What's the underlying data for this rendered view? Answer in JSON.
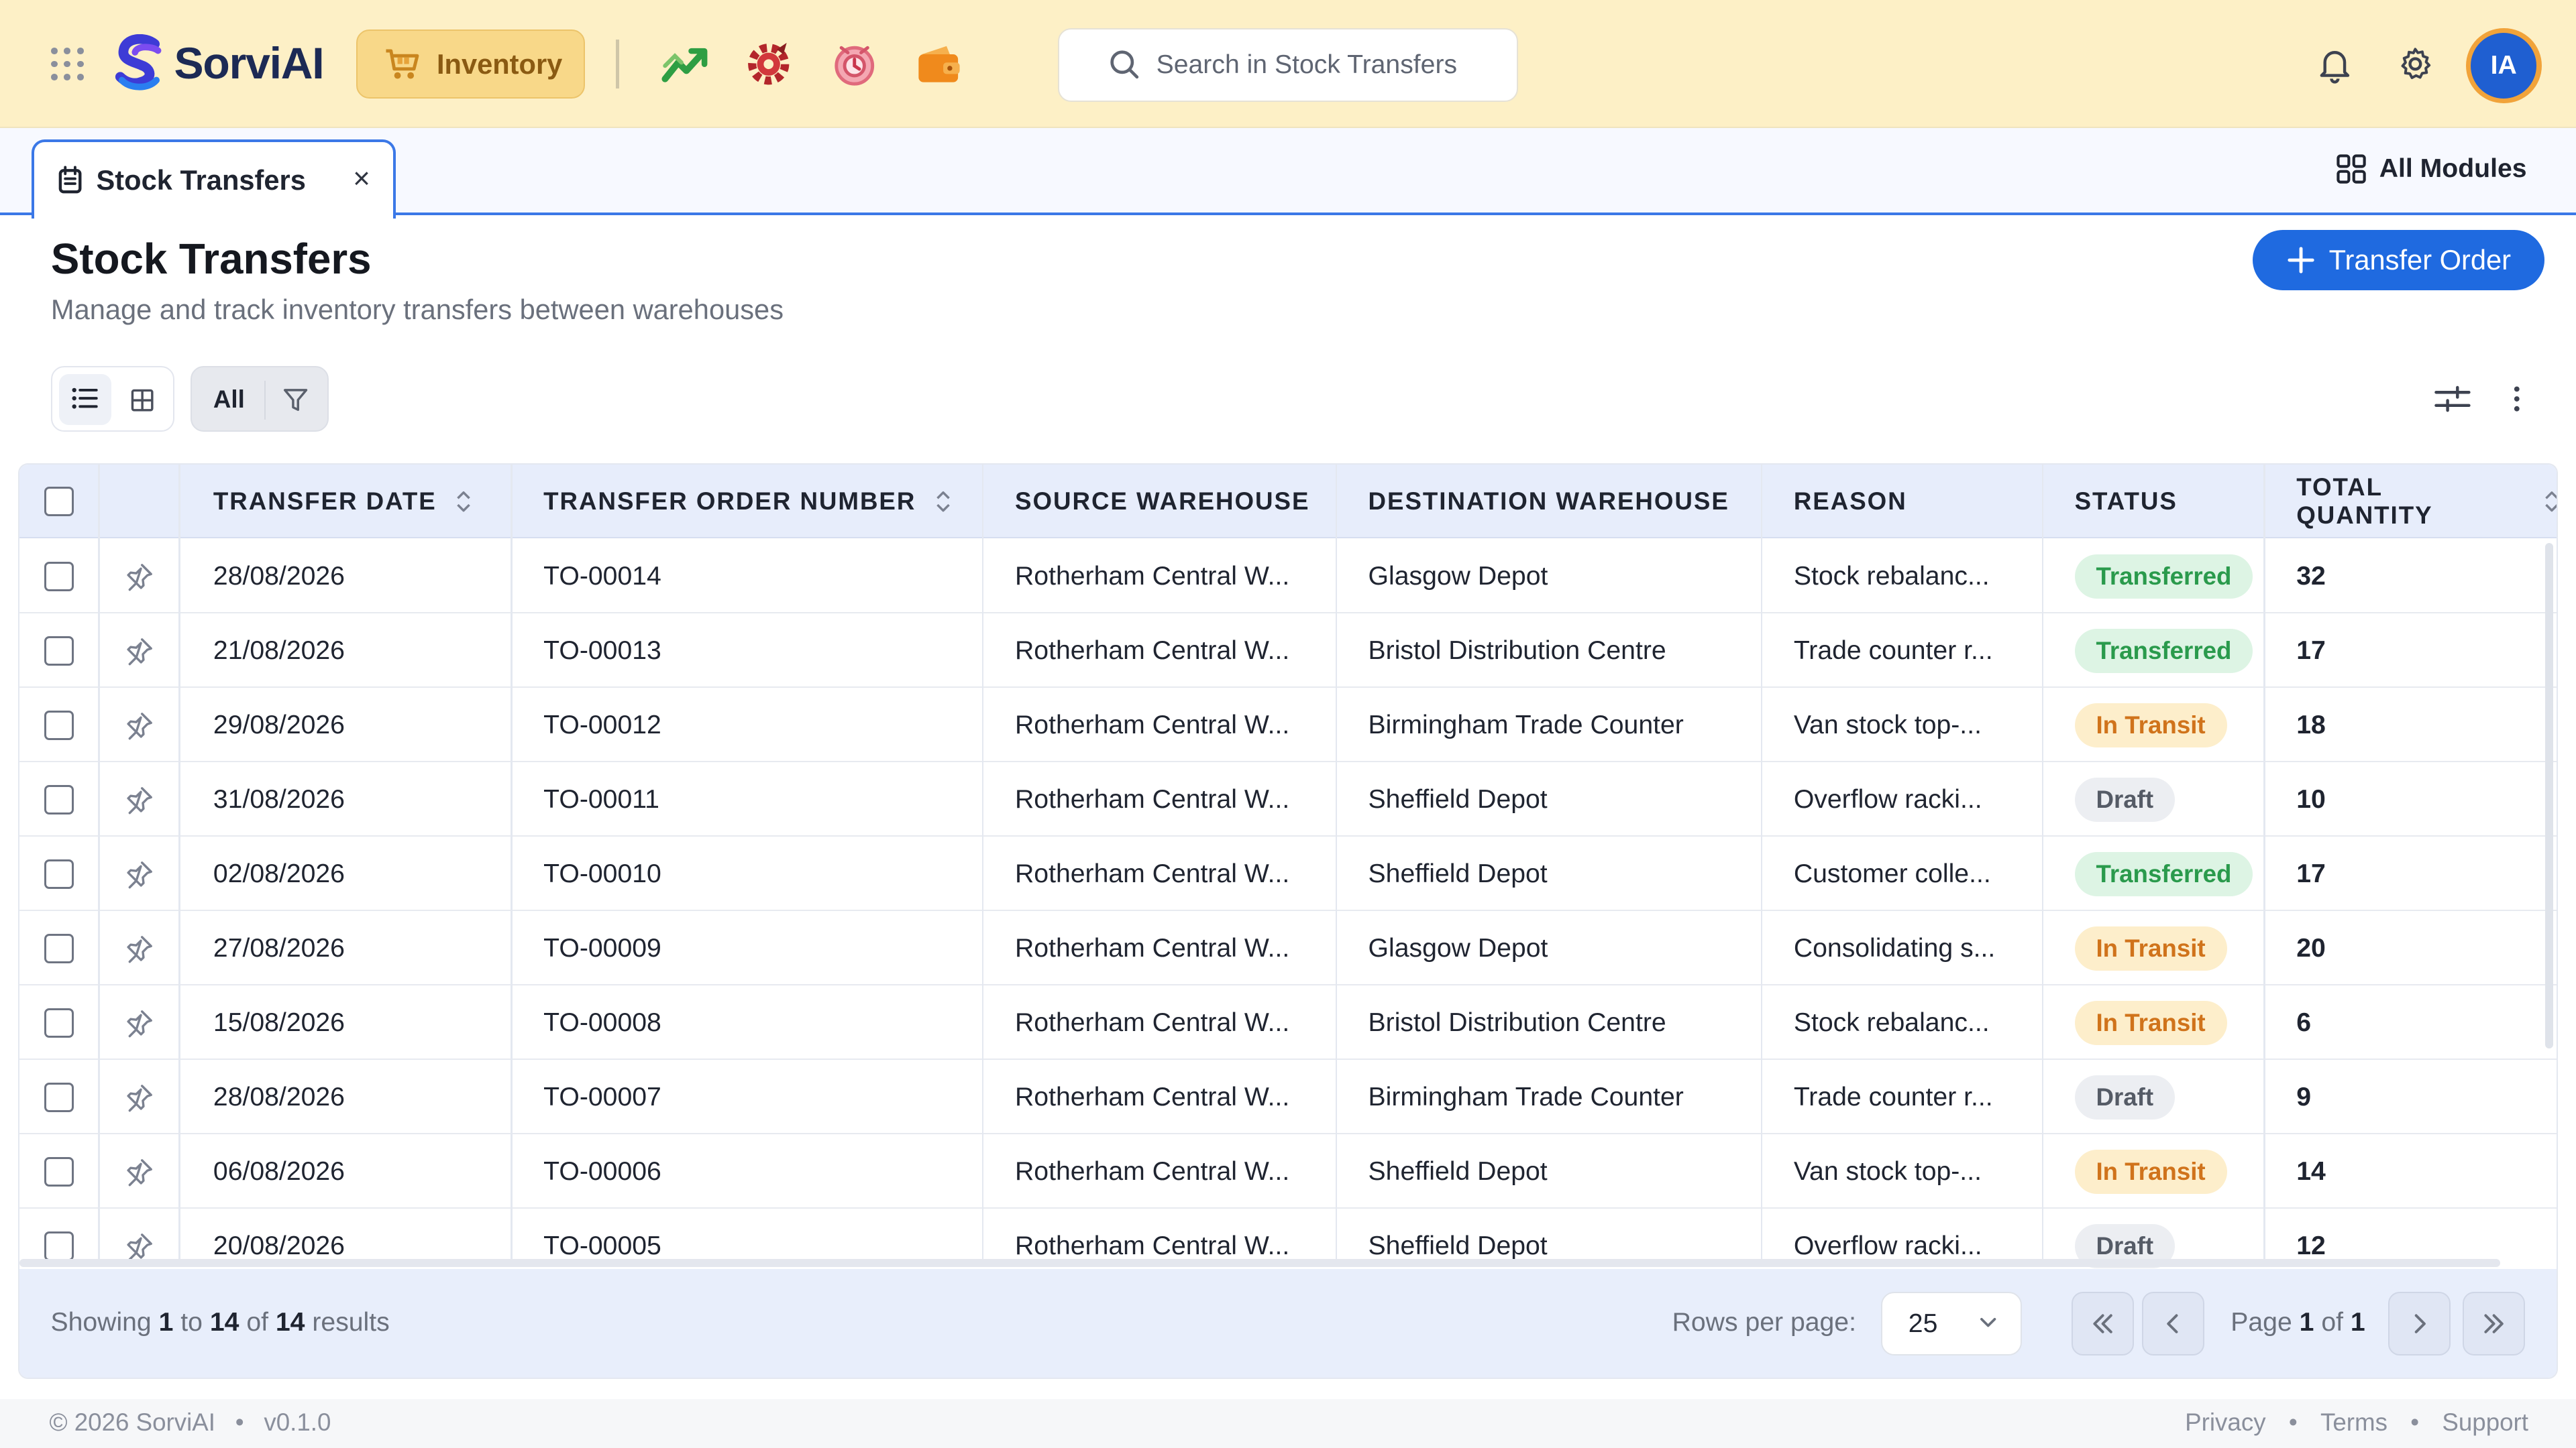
{
  "topbar": {
    "brand": "SorviAI",
    "module": "Inventory",
    "search_placeholder": "Search in Stock Transfers",
    "avatar_initials": "IA"
  },
  "tabs": {
    "active_tab": "Stock Transfers",
    "close_glyph": "×",
    "all_modules": "All Modules"
  },
  "page": {
    "title": "Stock Transfers",
    "subtitle": "Manage and track inventory transfers between warehouses",
    "primary_button": "Transfer Order"
  },
  "toolbar": {
    "filter_all": "All"
  },
  "table": {
    "columns": {
      "transfer_date": "TRANSFER DATE",
      "transfer_order_number": "TRANSFER ORDER NUMBER",
      "source_warehouse": "SOURCE WAREHOUSE",
      "destination_warehouse": "DESTINATION WAREHOUSE",
      "reason": "REASON",
      "status": "STATUS",
      "total_quantity": "TOTAL QUANTITY"
    },
    "rows": [
      {
        "date": "28/08/2026",
        "order": "TO-00014",
        "source": "Rotherham Central W...",
        "dest": "Glasgow Depot",
        "reason": "Stock rebalanc...",
        "status": "Transferred",
        "qty": "32"
      },
      {
        "date": "21/08/2026",
        "order": "TO-00013",
        "source": "Rotherham Central W...",
        "dest": "Bristol Distribution Centre",
        "reason": "Trade counter r...",
        "status": "Transferred",
        "qty": "17"
      },
      {
        "date": "29/08/2026",
        "order": "TO-00012",
        "source": "Rotherham Central W...",
        "dest": "Birmingham Trade Counter",
        "reason": "Van stock top-...",
        "status": "In Transit",
        "qty": "18"
      },
      {
        "date": "31/08/2026",
        "order": "TO-00011",
        "source": "Rotherham Central W...",
        "dest": "Sheffield Depot",
        "reason": "Overflow racki...",
        "status": "Draft",
        "qty": "10"
      },
      {
        "date": "02/08/2026",
        "order": "TO-00010",
        "source": "Rotherham Central W...",
        "dest": "Sheffield Depot",
        "reason": "Customer colle...",
        "status": "Transferred",
        "qty": "17"
      },
      {
        "date": "27/08/2026",
        "order": "TO-00009",
        "source": "Rotherham Central W...",
        "dest": "Glasgow Depot",
        "reason": "Consolidating s...",
        "status": "In Transit",
        "qty": "20"
      },
      {
        "date": "15/08/2026",
        "order": "TO-00008",
        "source": "Rotherham Central W...",
        "dest": "Bristol Distribution Centre",
        "reason": "Stock rebalanc...",
        "status": "In Transit",
        "qty": "6"
      },
      {
        "date": "28/08/2026",
        "order": "TO-00007",
        "source": "Rotherham Central W...",
        "dest": "Birmingham Trade Counter",
        "reason": "Trade counter r...",
        "status": "Draft",
        "qty": "9"
      },
      {
        "date": "06/08/2026",
        "order": "TO-00006",
        "source": "Rotherham Central W...",
        "dest": "Sheffield Depot",
        "reason": "Van stock top-...",
        "status": "In Transit",
        "qty": "14"
      },
      {
        "date": "20/08/2026",
        "order": "TO-00005",
        "source": "Rotherham Central W...",
        "dest": "Sheffield Depot",
        "reason": "Overflow racki...",
        "status": "Draft",
        "qty": "12"
      }
    ]
  },
  "pagination": {
    "showing_prefix": "Showing",
    "from": "1",
    "to_word": "to",
    "to": "14",
    "of_word": "of",
    "total": "14",
    "results_word": "results",
    "rows_per_page_label": "Rows per page:",
    "rows_per_page": "25",
    "page_word": "Page",
    "current_page": "1",
    "page_of": "of",
    "page_count": "1"
  },
  "footer": {
    "copyright": "© 2026 SorviAI",
    "version": "v0.1.0",
    "links": [
      "Privacy",
      "Terms",
      "Support"
    ],
    "separator": "•"
  },
  "colors": {
    "topbar_bg": "#fdf0c6",
    "accent": "#1f6ae0",
    "status_transferred": "#2a9a4c",
    "status_in_transit": "#d0731b",
    "status_draft": "#555b66"
  },
  "icons": [
    "apps-grid-icon",
    "sorviai-logo-icon",
    "inventory-cart-icon",
    "sales-chart-icon",
    "service-gear-icon",
    "crm-badge-icon",
    "wallet-icon",
    "search-icon",
    "bell-icon",
    "gear-icon",
    "document-icon",
    "close-icon",
    "modules-grid-icon",
    "plus-icon",
    "list-view-icon",
    "grid-view-icon",
    "filter-icon",
    "sliders-icon",
    "kebab-icon",
    "pin-icon",
    "sort-icon",
    "chevron-down-icon",
    "first-page-icon",
    "prev-page-icon",
    "next-page-icon",
    "last-page-icon"
  ]
}
